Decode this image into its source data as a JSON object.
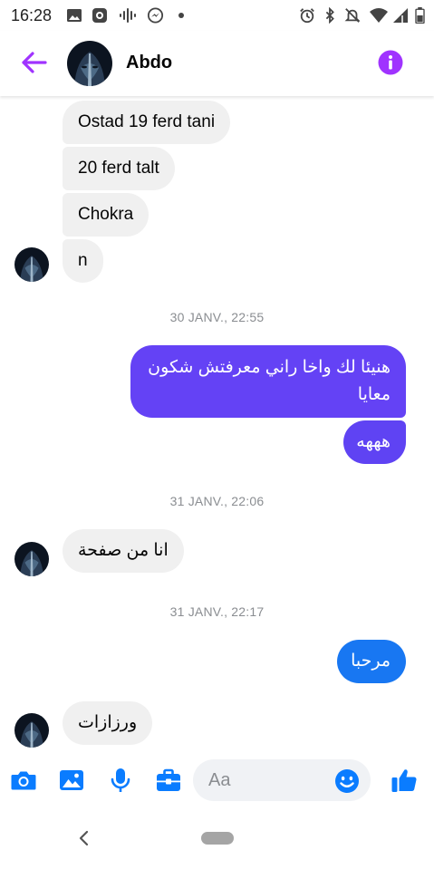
{
  "status_bar": {
    "time": "16:28",
    "left_icons": [
      "image-icon",
      "camera-app-icon",
      "audio-wave-icon",
      "messenger-icon",
      "dot-icon"
    ],
    "right_icons": [
      "alarm-icon",
      "bluetooth-icon",
      "bell-off-icon",
      "wifi-icon",
      "signal-icon",
      "battery-icon"
    ]
  },
  "header": {
    "contact_name": "Abdo",
    "accent_color": "#a033ff"
  },
  "messages": [
    {
      "sender": "contact",
      "text": "Ostad 19 ferd tani"
    },
    {
      "sender": "contact",
      "text": "20 ferd talt"
    },
    {
      "sender": "contact",
      "text": "Chokra"
    },
    {
      "sender": "contact",
      "text": "n"
    },
    {
      "type": "timestamp",
      "text": "30 JANV., 22:55"
    },
    {
      "sender": "me",
      "lines": [
        "هنيئا لك واخا راني معرفتش شكون",
        "معايا"
      ],
      "color": "#6442f5"
    },
    {
      "sender": "me",
      "text": "هههه",
      "color": "#5f43f3"
    },
    {
      "type": "timestamp",
      "text": "31 JANV., 22:06"
    },
    {
      "sender": "contact",
      "text": "انا من صفحة"
    },
    {
      "type": "timestamp",
      "text": "31 JANV., 22:17"
    },
    {
      "sender": "me",
      "text": "مرحبا",
      "color": "#1877f2"
    },
    {
      "sender": "contact",
      "text": "ورزازات"
    }
  ],
  "composer": {
    "placeholder": "Aa",
    "icon_color": "#0a7cff",
    "icons": [
      "camera-icon",
      "gallery-icon",
      "microphone-icon",
      "briefcase-icon",
      "emoji-icon",
      "thumbs-up-icon"
    ]
  }
}
